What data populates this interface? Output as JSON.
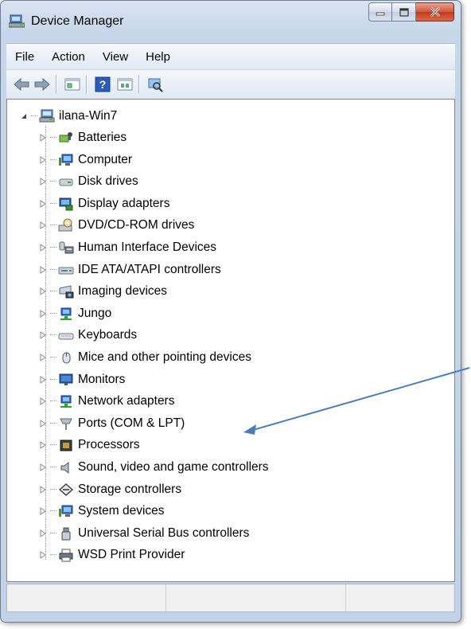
{
  "window": {
    "title": "Device Manager",
    "accent_close": "#c33a1d",
    "frame_color": "#c7d6ea"
  },
  "menu": {
    "items": [
      "File",
      "Action",
      "View",
      "Help"
    ]
  },
  "toolbar": {
    "buttons": [
      "back-arrow-icon",
      "forward-arrow-icon",
      "properties-icon",
      "help-icon",
      "show-hidden-icon",
      "scan-hardware-icon"
    ]
  },
  "tree": {
    "root": "ilana-Win7",
    "items": [
      {
        "label": "Batteries",
        "icon": "battery-icon"
      },
      {
        "label": "Computer",
        "icon": "computer-icon"
      },
      {
        "label": "Disk drives",
        "icon": "disk-drive-icon"
      },
      {
        "label": "Display adapters",
        "icon": "display-adapter-icon"
      },
      {
        "label": "DVD/CD-ROM drives",
        "icon": "dvd-drive-icon"
      },
      {
        "label": "Human Interface Devices",
        "icon": "hid-icon"
      },
      {
        "label": "IDE ATA/ATAPI controllers",
        "icon": "ide-controller-icon"
      },
      {
        "label": "Imaging devices",
        "icon": "camera-icon"
      },
      {
        "label": "Jungo",
        "icon": "network-icon"
      },
      {
        "label": "Keyboards",
        "icon": "keyboard-icon"
      },
      {
        "label": "Mice and other pointing devices",
        "icon": "mouse-icon"
      },
      {
        "label": "Monitors",
        "icon": "monitor-icon"
      },
      {
        "label": "Network adapters",
        "icon": "network-adapter-icon"
      },
      {
        "label": "Ports (COM & LPT)",
        "icon": "port-icon"
      },
      {
        "label": "Processors",
        "icon": "processor-icon"
      },
      {
        "label": "Sound, video and game controllers",
        "icon": "speaker-icon"
      },
      {
        "label": "Storage controllers",
        "icon": "storage-controller-icon"
      },
      {
        "label": "System devices",
        "icon": "system-device-icon"
      },
      {
        "label": "Universal Serial Bus controllers",
        "icon": "usb-icon"
      },
      {
        "label": "WSD Print Provider",
        "icon": "printer-icon"
      }
    ]
  },
  "annotation": {
    "arrow_color": "#4a7ebb",
    "points_to": "Ports (COM & LPT)"
  }
}
